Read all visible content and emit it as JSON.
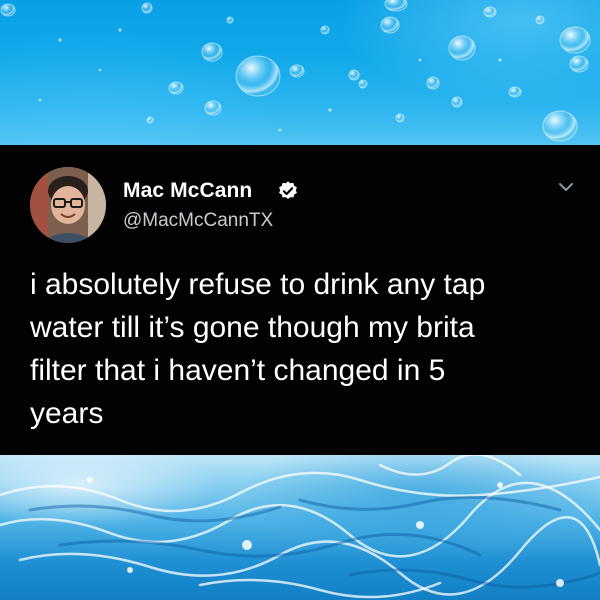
{
  "tweet": {
    "author_name": "Mac McCann",
    "handle": "@MacMcCannTX",
    "verified": true,
    "text_lines": [
      "i absolutely refuse to drink any tap",
      "water till it’s gone though my brita",
      "filter that i haven’t changed in 5",
      "years"
    ]
  },
  "icons": {
    "verified": "verified-badge-icon",
    "more": "chevron-down-icon"
  },
  "colors": {
    "tweet_background": "#020202",
    "text": "#ffffff",
    "handle_text": "#c7cdd2",
    "water_blue": "#12a9ea"
  }
}
